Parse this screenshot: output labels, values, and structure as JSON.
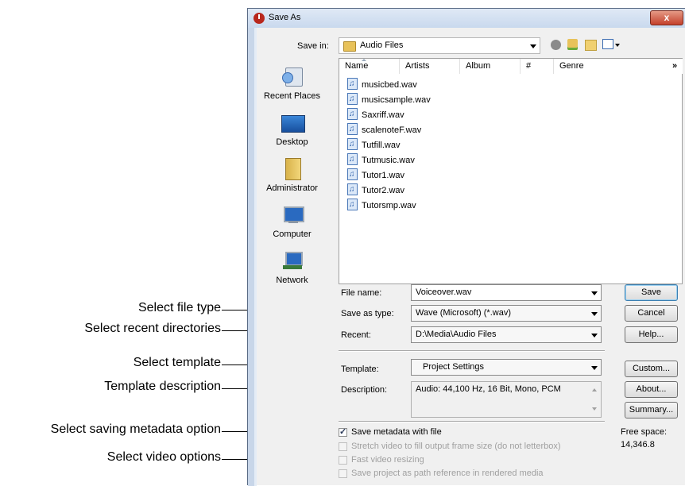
{
  "dialog": {
    "title": "Save As",
    "close_label": "x",
    "save_in_label": "Save in:",
    "save_in_value": "Audio Files",
    "toolbar_icons": [
      "back-icon",
      "up-folder-icon",
      "new-folder-icon",
      "view-menu-icon"
    ]
  },
  "places": [
    {
      "label": "Recent Places",
      "icon": "recent-places-icon"
    },
    {
      "label": "Desktop",
      "icon": "desktop-icon"
    },
    {
      "label": "Administrator",
      "icon": "user-folder-icon"
    },
    {
      "label": "Computer",
      "icon": "computer-icon"
    },
    {
      "label": "Network",
      "icon": "network-icon"
    }
  ],
  "file_list": {
    "columns": [
      "Name",
      "Artists",
      "Album",
      "#",
      "Genre"
    ],
    "more_columns": "»",
    "files": [
      "musicbed.wav",
      "musicsample.wav",
      "Saxriff.wav",
      "scalenoteF.wav",
      "Tutfill.wav",
      "Tutmusic.wav",
      "Tutor1.wav",
      "Tutor2.wav",
      "Tutorsmp.wav"
    ]
  },
  "form": {
    "file_name_label": "File name:",
    "file_name_value": "Voiceover.wav",
    "save_type_label": "Save as type:",
    "save_type_value": "Wave (Microsoft) (*.wav)",
    "recent_label": "Recent:",
    "recent_value": "D:\\Media\\Audio Files",
    "template_label": "Template:",
    "template_value": "Project Settings",
    "description_label": "Description:",
    "description_value": "Audio: 44,100 Hz, 16 Bit, Mono, PCM"
  },
  "buttons": {
    "save": "Save",
    "cancel": "Cancel",
    "help": "Help...",
    "custom": "Custom...",
    "about": "About...",
    "summary": "Summary..."
  },
  "options": {
    "save_metadata": {
      "label": "Save metadata with file",
      "checked": true
    },
    "stretch_video": {
      "label": "Stretch video to fill output frame size (do not letterbox)",
      "checked": false
    },
    "fast_resize": {
      "label": "Fast video resizing",
      "checked": false
    },
    "path_reference": {
      "label": "Save project as path reference in rendered media",
      "checked": false
    }
  },
  "free_space": {
    "label": "Free space:",
    "value": "14,346.8"
  },
  "annotations": {
    "file_type": "Select file type",
    "recent_dirs": "Select recent directories",
    "template": "Select template",
    "template_desc": "Template description",
    "metadata": "Select saving metadata option",
    "video": "Select video options"
  },
  "colors": {
    "dialog_bg": "#f0f0f0",
    "close_button": "#c4402b",
    "title_gradient": "#c9d9ee"
  }
}
